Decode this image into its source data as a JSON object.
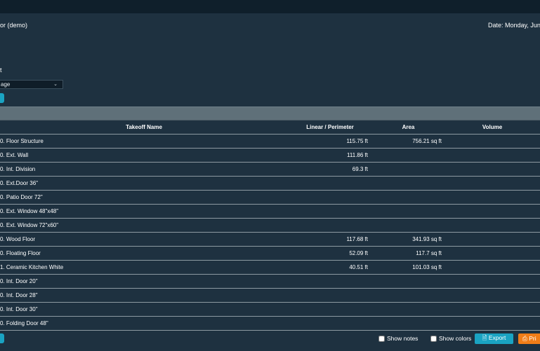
{
  "header": {
    "title": "or (demo)",
    "date": "Date: Monday, June"
  },
  "options": {
    "section_label": "t",
    "select_value": "age"
  },
  "table": {
    "columns": [
      "Takeoff Name",
      "Linear / Perimeter",
      "Area",
      "Volume"
    ],
    "rows": [
      {
        "name": "0. Floor Structure",
        "linear": "115.75 ft",
        "area": "756.21 sq ft",
        "volume": ""
      },
      {
        "name": "0. Ext. Wall",
        "linear": "111.86 ft",
        "area": "",
        "volume": ""
      },
      {
        "name": "0. Int. Division",
        "linear": "69.3 ft",
        "area": "",
        "volume": ""
      },
      {
        "name": "0. Ext.Door 36\"",
        "linear": "",
        "area": "",
        "volume": ""
      },
      {
        "name": "0. Patio Door 72\"",
        "linear": "",
        "area": "",
        "volume": ""
      },
      {
        "name": "0. Ext. Window 48\"x48\"",
        "linear": "",
        "area": "",
        "volume": ""
      },
      {
        "name": "0. Ext. Window 72\"x60\"",
        "linear": "",
        "area": "",
        "volume": ""
      },
      {
        "name": "0. Wood Floor",
        "linear": "117.68 ft",
        "area": "341.93 sq ft",
        "volume": ""
      },
      {
        "name": "0. Floating Floor",
        "linear": "52.09 ft",
        "area": "117.7 sq ft",
        "volume": ""
      },
      {
        "name": "1. Ceramic Kitchen White",
        "linear": "40.51 ft",
        "area": "101.03 sq ft",
        "volume": ""
      },
      {
        "name": "0. Int. Door 20\"",
        "linear": "",
        "area": "",
        "volume": ""
      },
      {
        "name": "0. Int. Door 28\"",
        "linear": "",
        "area": "",
        "volume": ""
      },
      {
        "name": "0. Int. Door 30\"",
        "linear": "",
        "area": "",
        "volume": ""
      },
      {
        "name": "0. Folding Door 48\"",
        "linear": "",
        "area": "",
        "volume": ""
      }
    ]
  },
  "footer": {
    "show_notes": "Show notes",
    "show_colors": "Show colors",
    "export": "Export",
    "print": "Pri",
    "export_icon": "file-export-icon",
    "print_icon": "printer-icon"
  },
  "colors": {
    "background": "#1e3140",
    "accent": "#1aa3c2",
    "print": "#f07d18"
  }
}
